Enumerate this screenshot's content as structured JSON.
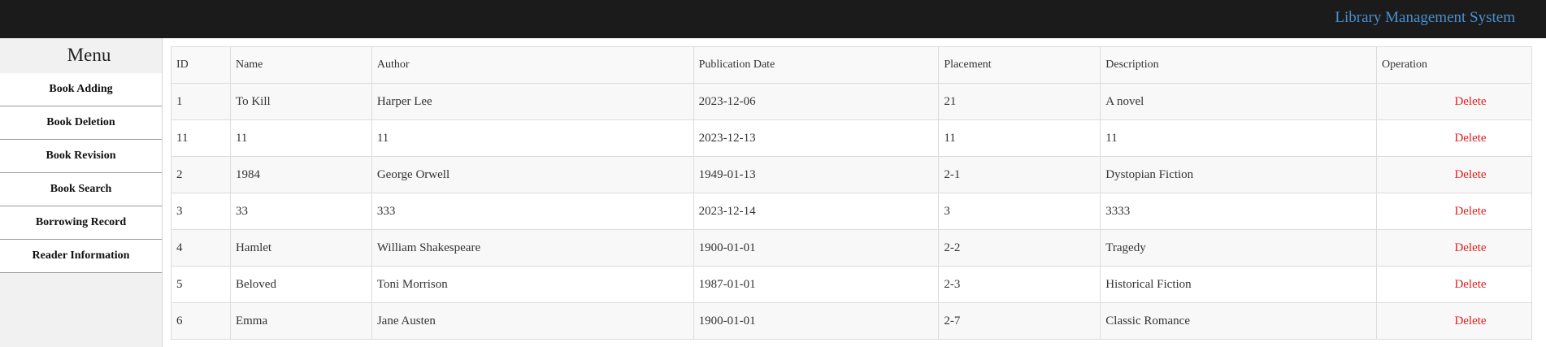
{
  "header": {
    "title": "Library Management System"
  },
  "sidebar": {
    "heading": "Menu",
    "items": [
      {
        "label": "Book Adding"
      },
      {
        "label": "Book Deletion"
      },
      {
        "label": "Book Revision"
      },
      {
        "label": "Book Search"
      },
      {
        "label": "Borrowing Record"
      },
      {
        "label": "Reader Information"
      }
    ]
  },
  "table": {
    "columns": [
      "ID",
      "Name",
      "Author",
      "Publication Date",
      "Placement",
      "Description",
      "Operation"
    ],
    "rows": [
      {
        "id": "1",
        "name": "To Kill",
        "author": "Harper Lee",
        "date": "2023-12-06",
        "placement": "21",
        "description": "A novel",
        "operation": "Delete"
      },
      {
        "id": "11",
        "name": "11",
        "author": "11",
        "date": "2023-12-13",
        "placement": "11",
        "description": "11",
        "operation": "Delete"
      },
      {
        "id": "2",
        "name": "1984",
        "author": "George Orwell",
        "date": "1949-01-13",
        "placement": "2-1",
        "description": "Dystopian Fiction",
        "operation": "Delete"
      },
      {
        "id": "3",
        "name": "33",
        "author": "333",
        "date": "2023-12-14",
        "placement": "3",
        "description": "3333",
        "operation": "Delete"
      },
      {
        "id": "4",
        "name": "Hamlet",
        "author": "William Shakespeare",
        "date": "1900-01-01",
        "placement": "2-2",
        "description": "Tragedy",
        "operation": "Delete"
      },
      {
        "id": "5",
        "name": "Beloved",
        "author": "Toni Morrison",
        "date": "1987-01-01",
        "placement": "2-3",
        "description": "Historical Fiction",
        "operation": "Delete"
      },
      {
        "id": "6",
        "name": "Emma",
        "author": "Jane Austen",
        "date": "1900-01-01",
        "placement": "2-7",
        "description": "Classic Romance",
        "operation": "Delete"
      }
    ]
  },
  "colors": {
    "topbar": "#1b1b1b",
    "title": "#4a8fd0",
    "delete": "#e01e1e"
  }
}
